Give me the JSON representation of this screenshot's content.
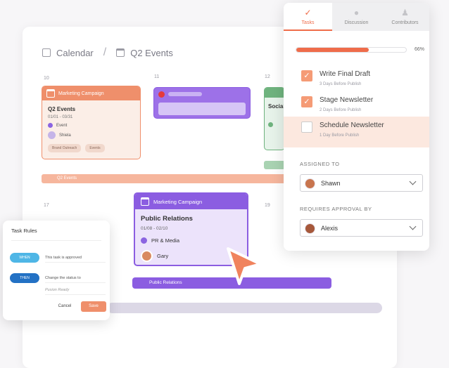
{
  "calendar": {
    "breadcrumb": [
      "Calendar",
      "Q2 Events"
    ],
    "day_numbers": [
      "10",
      "11",
      "12",
      "17",
      "19"
    ],
    "event_orange": {
      "header": "Marketing Campaign",
      "title": "Q2 Events",
      "dates": "01/01 - 03/31",
      "type": "Event",
      "owner": "Shiela",
      "tags": [
        "Brand Outreach",
        "Events"
      ]
    },
    "event_green_title": "Social",
    "band_q2": "Q2 Events",
    "event_purple": {
      "header": "Marketing Campaign",
      "title": "Public Relations",
      "dates": "01/08 - 02/10",
      "type": "PR & Media",
      "owner": "Gary"
    },
    "band_pr": "Public Relations"
  },
  "task_rules": {
    "title": "Task Rules",
    "when_label": "WHEN",
    "when_value": "This task is approved",
    "then_label": "THEN",
    "then_value": "Change the status to",
    "then_status": "Pusion Ready",
    "cancel_label": "Cancel",
    "save_label": "Save"
  },
  "panel": {
    "tabs": [
      {
        "label": "Tasks",
        "icon": "check-icon",
        "active": true
      },
      {
        "label": "Discussion",
        "icon": "chat-icon",
        "active": false
      },
      {
        "label": "Contributors",
        "icon": "users-icon",
        "active": false
      }
    ],
    "progress_value": 66,
    "progress_label": "66%",
    "tasks": [
      {
        "name": "Write Final Draft",
        "due": "3 Days Before Publish",
        "done": true
      },
      {
        "name": "Stage Newsletter",
        "due": "2 Days Before Publish",
        "done": true
      },
      {
        "name": "Schedule Newsletter",
        "due": "1 Day Before Publish",
        "done": false
      }
    ],
    "assigned_label": "ASSIGNED TO",
    "assigned_value": "Shawn",
    "approval_label": "REQUIRES APPROVAL BY",
    "approval_value": "Alexis"
  },
  "colors": {
    "accent": "#ef6c4a",
    "purple": "#8b5de1",
    "orange_event": "#ef8f6b",
    "green_event": "#6fb37e"
  }
}
